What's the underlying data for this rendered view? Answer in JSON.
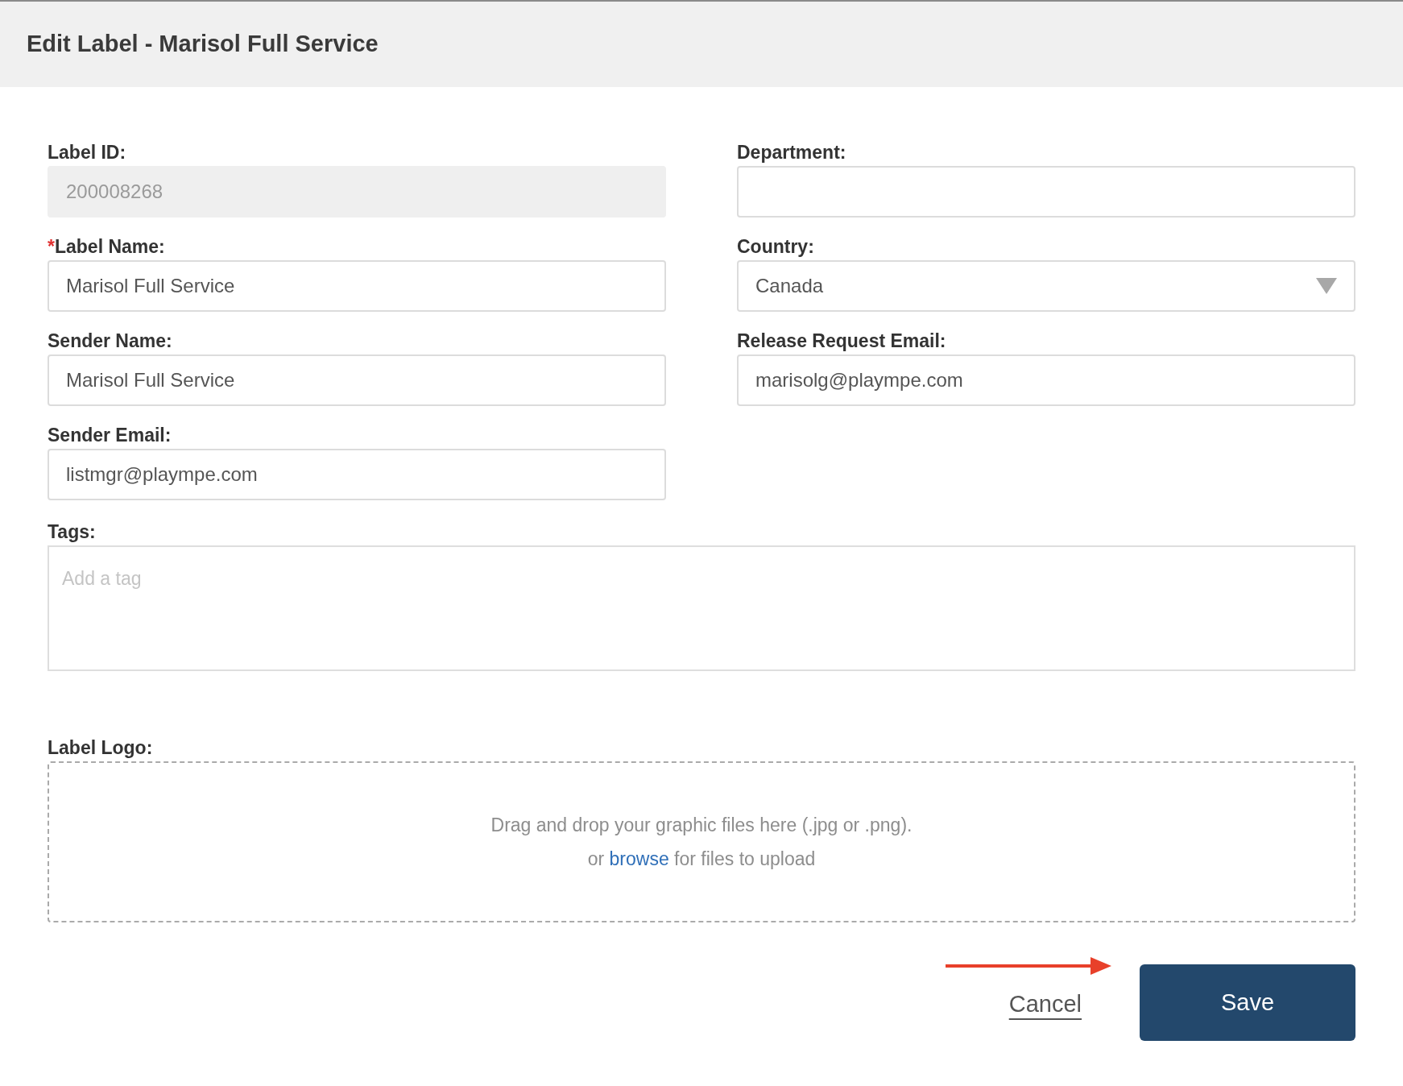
{
  "dialog": {
    "title": "Edit Label - Marisol Full Service"
  },
  "left_column": [
    {
      "kind": "text",
      "label": "Label ID:",
      "value": "200008268",
      "disabled": true
    },
    {
      "kind": "text",
      "label": "Label Name:",
      "required_mark": "*",
      "value": "Marisol Full Service",
      "disabled": false
    },
    {
      "kind": "text",
      "label": "Sender Name:",
      "value": "Marisol Full Service",
      "disabled": false
    },
    {
      "kind": "text",
      "label": "Sender Email:",
      "value": "listmgr@plaympe.com",
      "disabled": false
    }
  ],
  "right_column": [
    {
      "kind": "text",
      "label": "Department:",
      "disabled": false
    },
    {
      "kind": "select",
      "label": "Country:",
      "value": "Canada",
      "disabled": false
    },
    {
      "kind": "text",
      "label": "Release Request Email:",
      "value": "marisolg@plaympe.com",
      "disabled": false
    }
  ],
  "tags": {
    "label": "Tags:",
    "placeholder": "Add a tag"
  },
  "logo": {
    "label": "Label Logo:",
    "drop_text": "Drag and drop your graphic files here (.jpg or .png).",
    "prefix": "or",
    "link": "browse",
    "suffix": "for files to upload"
  },
  "buttons": {
    "cancel": "Cancel",
    "save": "Save"
  }
}
